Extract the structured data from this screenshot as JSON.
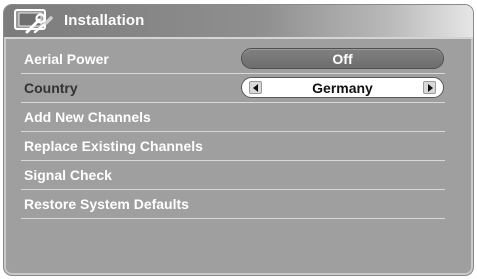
{
  "title_bar": {
    "title": "Installation",
    "icon": "tools-icon"
  },
  "menu": {
    "items": [
      {
        "label": "Aerial Power",
        "value": "Off",
        "control": "value-pill"
      },
      {
        "label": "Country",
        "value": "Germany",
        "control": "selector",
        "selected": true
      },
      {
        "label": "Add New Channels"
      },
      {
        "label": "Replace Existing Channels"
      },
      {
        "label": "Signal Check"
      },
      {
        "label": "Restore System Defaults"
      }
    ]
  },
  "colors": {
    "panel": "#9f9f9f",
    "title_bar_dark": "#7c7c7c",
    "divider": "#d8d8d8",
    "selected_text": "#333333"
  }
}
